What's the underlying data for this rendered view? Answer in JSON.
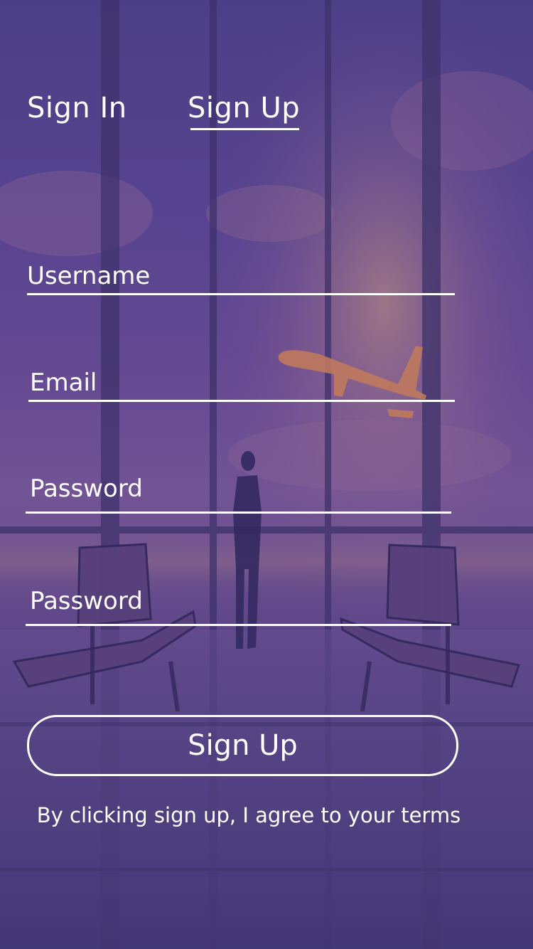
{
  "tabs": {
    "sign_in": "Sign In",
    "sign_up": "Sign Up",
    "active": "sign_up"
  },
  "form": {
    "username_placeholder": "Username",
    "email_placeholder": "Email",
    "password_placeholder": "Password",
    "confirm_password_placeholder": "Password"
  },
  "submit_label": "Sign Up",
  "terms_text": "By clicking sign up, I agree to your terms",
  "colors": {
    "overlay": "#4f4188",
    "text": "#ffffff",
    "sunset_glow": "#f0a46a"
  },
  "icons": {
    "airplane": "airplane-icon",
    "traveler": "person-silhouette",
    "seats": "airport-bench"
  }
}
